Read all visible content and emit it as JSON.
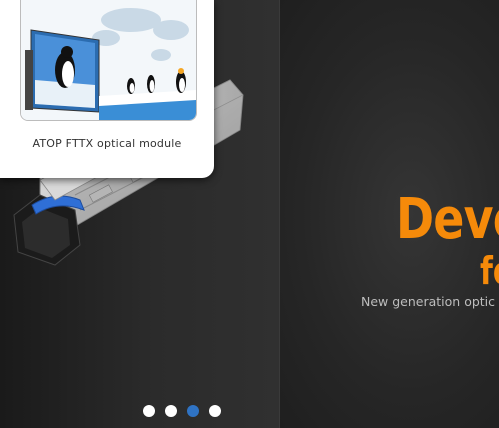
{
  "popup": {
    "caption": "ATOP FTTX optical module"
  },
  "banner": {
    "headline_line1": "Deve",
    "headline_line2": "fo",
    "tagline": "New generation optic"
  },
  "slider": {
    "dots": [
      {
        "label": "slide 1",
        "active": false
      },
      {
        "label": "slide 2",
        "active": false
      },
      {
        "label": "slide 3",
        "active": true
      },
      {
        "label": "slide 4",
        "active": false
      }
    ]
  },
  "colors": {
    "headline": "#f58a0a",
    "active_dot": "#2f73c4",
    "background": "#2a2a2a"
  }
}
